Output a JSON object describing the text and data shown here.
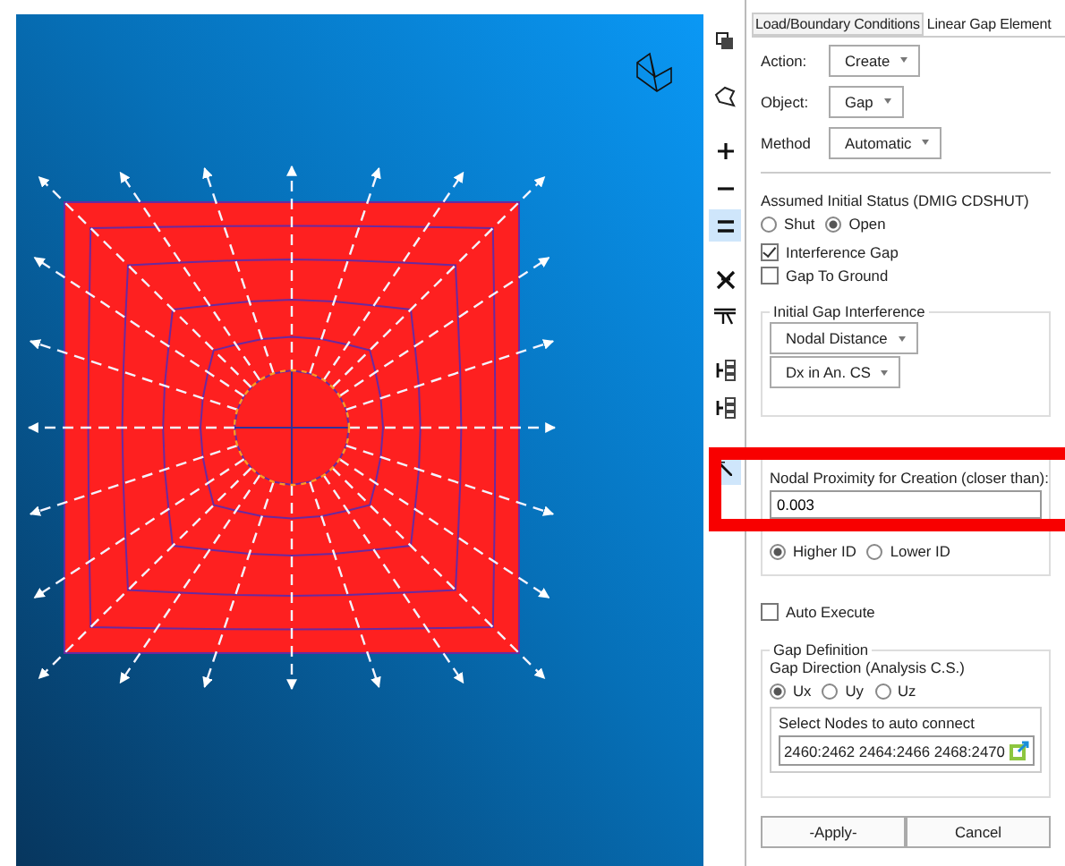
{
  "toolbar": [
    {
      "kind": "copy",
      "selected": false
    },
    {
      "kind": "lasso",
      "selected": false
    },
    {
      "kind": "plus",
      "selected": false
    },
    {
      "kind": "minus",
      "selected": false
    },
    {
      "kind": "equal",
      "selected": true
    },
    {
      "kind": "cross",
      "selected": false
    },
    {
      "kind": "filter",
      "selected": false
    },
    {
      "kind": "list",
      "selected": false
    },
    {
      "kind": "list",
      "selected": false
    },
    {
      "kind": "pointer",
      "selected": true
    }
  ],
  "tabs": [
    {
      "label": "Load/Boundary Conditions",
      "selected": false
    },
    {
      "label": "Linear Gap Element",
      "selected": true
    }
  ],
  "fields": [
    {
      "label": "Action:",
      "value": "Create"
    },
    {
      "label": "Object:",
      "value": "Gap"
    },
    {
      "label": "Method",
      "value": "Automatic"
    }
  ],
  "status": {
    "label": "Assumed Initial Status (DMIG CDSHUT)",
    "options": [
      {
        "label": "Shut",
        "selected": false
      },
      {
        "label": "Open",
        "selected": true
      }
    ]
  },
  "checkboxes": [
    {
      "label": "Interference Gap",
      "checked": true
    },
    {
      "label": "Gap To Ground",
      "checked": false
    }
  ],
  "initial_gap": {
    "title": "Initial Gap Interference",
    "dropdowns": [
      "Nodal Distance",
      "Dx in An. CS"
    ]
  },
  "proximity": {
    "label": "Nodal Proximity for Creation (closer than):",
    "value": "0.003"
  },
  "id_options": [
    {
      "label": "Higher ID",
      "selected": true
    },
    {
      "label": "Lower ID",
      "selected": false
    }
  ],
  "auto_execute": {
    "label": "Auto Execute",
    "checked": false
  },
  "gap_definition": {
    "title": "Gap Definition",
    "direction_label": "Gap Direction (Analysis C.S.)",
    "options": [
      {
        "label": "Ux",
        "selected": true
      },
      {
        "label": "Uy",
        "selected": false
      },
      {
        "label": "Uz",
        "selected": false
      }
    ],
    "nodes_label": "Select Nodes to auto connect",
    "nodes_value": "2460:2462 2464:2466 2468:2470"
  },
  "buttons": [
    "-Apply-",
    "Cancel"
  ]
}
